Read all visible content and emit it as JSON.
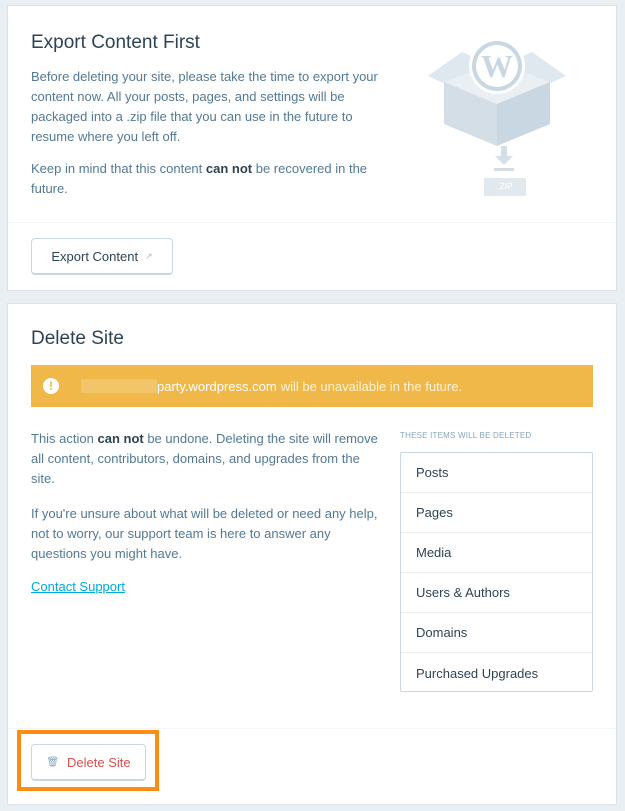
{
  "export": {
    "title": "Export Content First",
    "description": "Before deleting your site, please take the time to export your content now. All your posts, pages, and settings will be packaged into a .zip file that you can use in the future to resume where you left off.",
    "note_prefix": "Keep in mind that this content ",
    "note_strong": "can not",
    "note_suffix": " be recovered in the future.",
    "button_label": "Export Content",
    "zip_label": ".ZIP"
  },
  "delete": {
    "title": "Delete Site",
    "warning_icon": "!",
    "warning_domain": "party.wordpress.com",
    "warning_text": "will be unavailable in the future.",
    "desc1_prefix": "This action ",
    "desc1_strong": "can not",
    "desc1_suffix": " be undone. Deleting the site will remove all content, contributors, domains, and upgrades from the site.",
    "desc2": "If you're unsure about what will be deleted or need any help, not to worry, our support team is here to answer any questions you might have.",
    "contact_link": "Contact Support",
    "items_heading": "THESE ITEMS WILL BE DELETED",
    "items": [
      "Posts",
      "Pages",
      "Media",
      "Users & Authors",
      "Domains",
      "Purchased Upgrades"
    ],
    "button_label": "Delete Site"
  },
  "colors": {
    "warning": "#f0b849",
    "danger": "#d94f4f",
    "link": "#00aadc",
    "highlight": "#ff8c12"
  }
}
